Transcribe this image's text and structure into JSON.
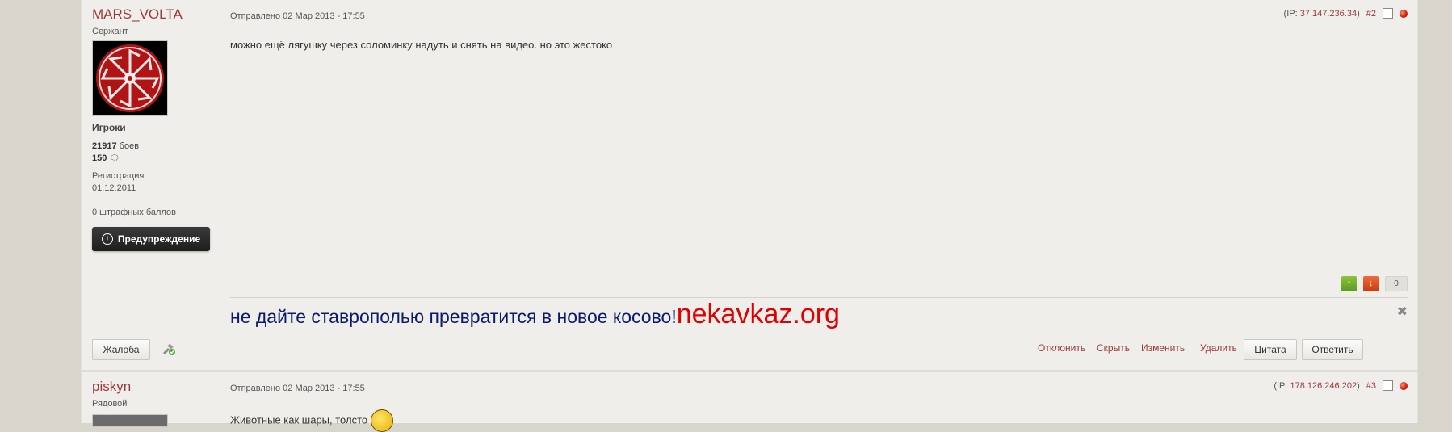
{
  "post1": {
    "username": "MARS_VOLTA",
    "rank": "Сержант",
    "group": "Игроки",
    "battles_count": "21917",
    "battles_label": "боев",
    "posts_count": "150",
    "reg_label": "Регистрация:",
    "reg_date": "01.12.2011",
    "penalty": "0 штрафных баллов",
    "warn_button": "Предупреждение",
    "posted": "Отправлено 02 Мар 2013 - 17:55",
    "ip_prefix": "(IP: ",
    "ip": "37.147.236.34",
    "ip_suffix": ")",
    "post_number": "#2",
    "body": "можно ещё лягушку через соломинку надуть и снять на видео. но это жестоко",
    "vote_count": "0",
    "signature_text": "не дайте ставрополью превратится в новое косово!",
    "signature_link": "nekavkaz.org",
    "report_button": "Жалоба",
    "actions": {
      "reject": "Отклонить",
      "hide": "Скрыть",
      "edit": "Изменить",
      "delete": "Удалить",
      "quote": "Цитата",
      "reply": "Ответить"
    }
  },
  "post2": {
    "username": "piskyn",
    "rank": "Рядовой",
    "posted": "Отправлено 02 Мар 2013 - 17:55",
    "ip_prefix": "(IP: ",
    "ip": "178.126.246.202",
    "ip_suffix": ")",
    "post_number": "#3",
    "body": "Животные как шары, толсто"
  },
  "colors": {
    "link": "#9b3a3a",
    "signature_text": "#0c1a6c",
    "signature_link": "#e00000",
    "vote_up": "#6aa82a",
    "vote_down": "#d94a1c"
  }
}
